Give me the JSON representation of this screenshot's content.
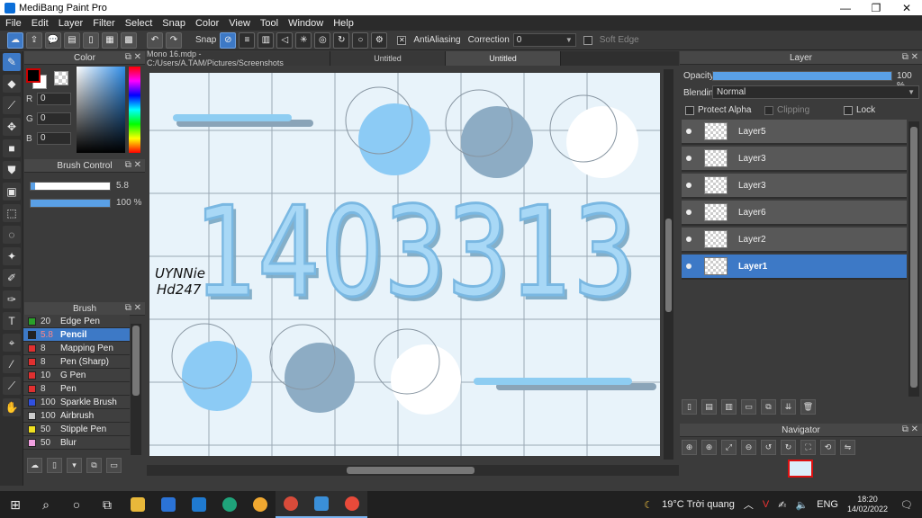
{
  "window": {
    "title": "MediBang Paint Pro",
    "controls": {
      "minimize": "—",
      "maximize": "❐",
      "close": "✕"
    }
  },
  "menu": [
    "File",
    "Edit",
    "Layer",
    "Filter",
    "Select",
    "Snap",
    "Color",
    "View",
    "Tool",
    "Window",
    "Help"
  ],
  "toolbar": {
    "snap_label": "Snap",
    "antialias_label": "AntiAliasing",
    "antialias_checked": true,
    "correction_label": "Correction",
    "correction_value": "0",
    "softedge_label": "Soft Edge",
    "softedge_checked": false
  },
  "color_panel": {
    "title": "Color",
    "r_label": "R",
    "r_value": "0",
    "g_label": "G",
    "g_value": "0",
    "b_label": "B",
    "b_value": "0",
    "foreground": "#000000",
    "background": "#ffffff"
  },
  "brush_control": {
    "title": "Brush Control",
    "size_value": "5.8",
    "size_fraction": 0.06,
    "opacity_value": "100 %",
    "opacity_fraction": 1.0
  },
  "brush_panel": {
    "title": "Brush",
    "items": [
      {
        "size": "20",
        "name": "Edge Pen",
        "color": "#2aa02a"
      },
      {
        "size": "5.8",
        "name": "Pencil",
        "color": "#222222",
        "selected": true
      },
      {
        "size": "8",
        "name": "Mapping Pen",
        "color": "#e03030"
      },
      {
        "size": "8",
        "name": "Pen (Sharp)",
        "color": "#e03030"
      },
      {
        "size": "10",
        "name": "G Pen",
        "color": "#e03030"
      },
      {
        "size": "8",
        "name": "Pen",
        "color": "#e03030"
      },
      {
        "size": "100",
        "name": "Sparkle Brush",
        "color": "#3050e0"
      },
      {
        "size": "100",
        "name": "Airbrush",
        "color": "#cccccc"
      },
      {
        "size": "50",
        "name": "Stipple Pen",
        "color": "#f0e020"
      },
      {
        "size": "50",
        "name": "Blur",
        "color": "#f0a0e0"
      }
    ]
  },
  "tabs": [
    {
      "label": "Mono 16.mdp - C:/Users/A.TAM/Pictures/Screenshots",
      "active": false
    },
    {
      "label": "Untitled",
      "active": false
    },
    {
      "label": "Untitled",
      "active": true
    }
  ],
  "canvas": {
    "big_text": "1403313",
    "signature_line1": "UYNNie",
    "signature_line2": "Hd247",
    "colors": {
      "light_blue": "#8ccbf5",
      "steel_blue": "#8dacc4",
      "white": "#ffffff",
      "bar_blue": "#8ecdf2",
      "bar_grey": "#8aa4b8",
      "grid": "#9aa8b4"
    }
  },
  "layer_panel": {
    "title": "Layer",
    "opacity_label": "Opacity",
    "opacity_value": "100 %",
    "opacity_fraction": 1.0,
    "blending_label": "Blending",
    "blending_value": "Normal",
    "protect_alpha_label": "Protect Alpha",
    "clipping_label": "Clipping",
    "lock_label": "Lock",
    "layers": [
      {
        "name": "Layer5",
        "selected": false
      },
      {
        "name": "Layer3",
        "selected": false
      },
      {
        "name": "Layer3",
        "selected": false
      },
      {
        "name": "Layer6",
        "selected": false
      },
      {
        "name": "Layer2",
        "selected": false
      },
      {
        "name": "Layer1",
        "selected": true
      }
    ]
  },
  "navigator": {
    "title": "Navigator"
  },
  "taskbar": {
    "weather": "19°C  Trời quang",
    "language": "ENG",
    "time": "18:20",
    "date": "14/02/2022"
  }
}
